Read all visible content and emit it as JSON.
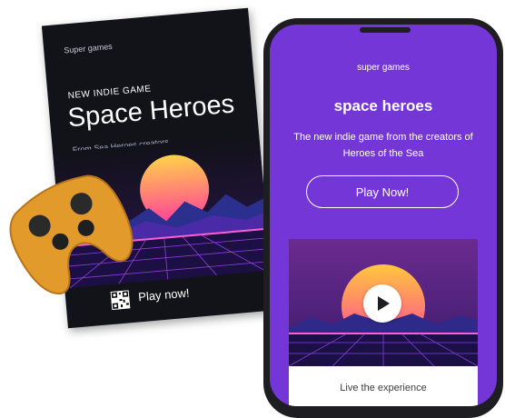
{
  "poster": {
    "brand": "Super games",
    "kicker": "NEW INDIE GAME",
    "title": "Space Heroes",
    "subtitle": "From Sea Heroes creators",
    "cta": "Play now!",
    "qr_icon": "qr-code-icon"
  },
  "phone": {
    "brand": "super games",
    "title": "space heroes",
    "description": "The new indie game from the creators of Heroes of the Sea",
    "play_button": "Play Now!",
    "video_caption": "Live the experience",
    "play_icon": "play-icon"
  },
  "colors": {
    "accent": "#7436d6",
    "poster_bg": "#121219",
    "controller": "#e29a2b",
    "sun_top": "#ffd24a",
    "sun_bottom": "#ff4aa0"
  }
}
